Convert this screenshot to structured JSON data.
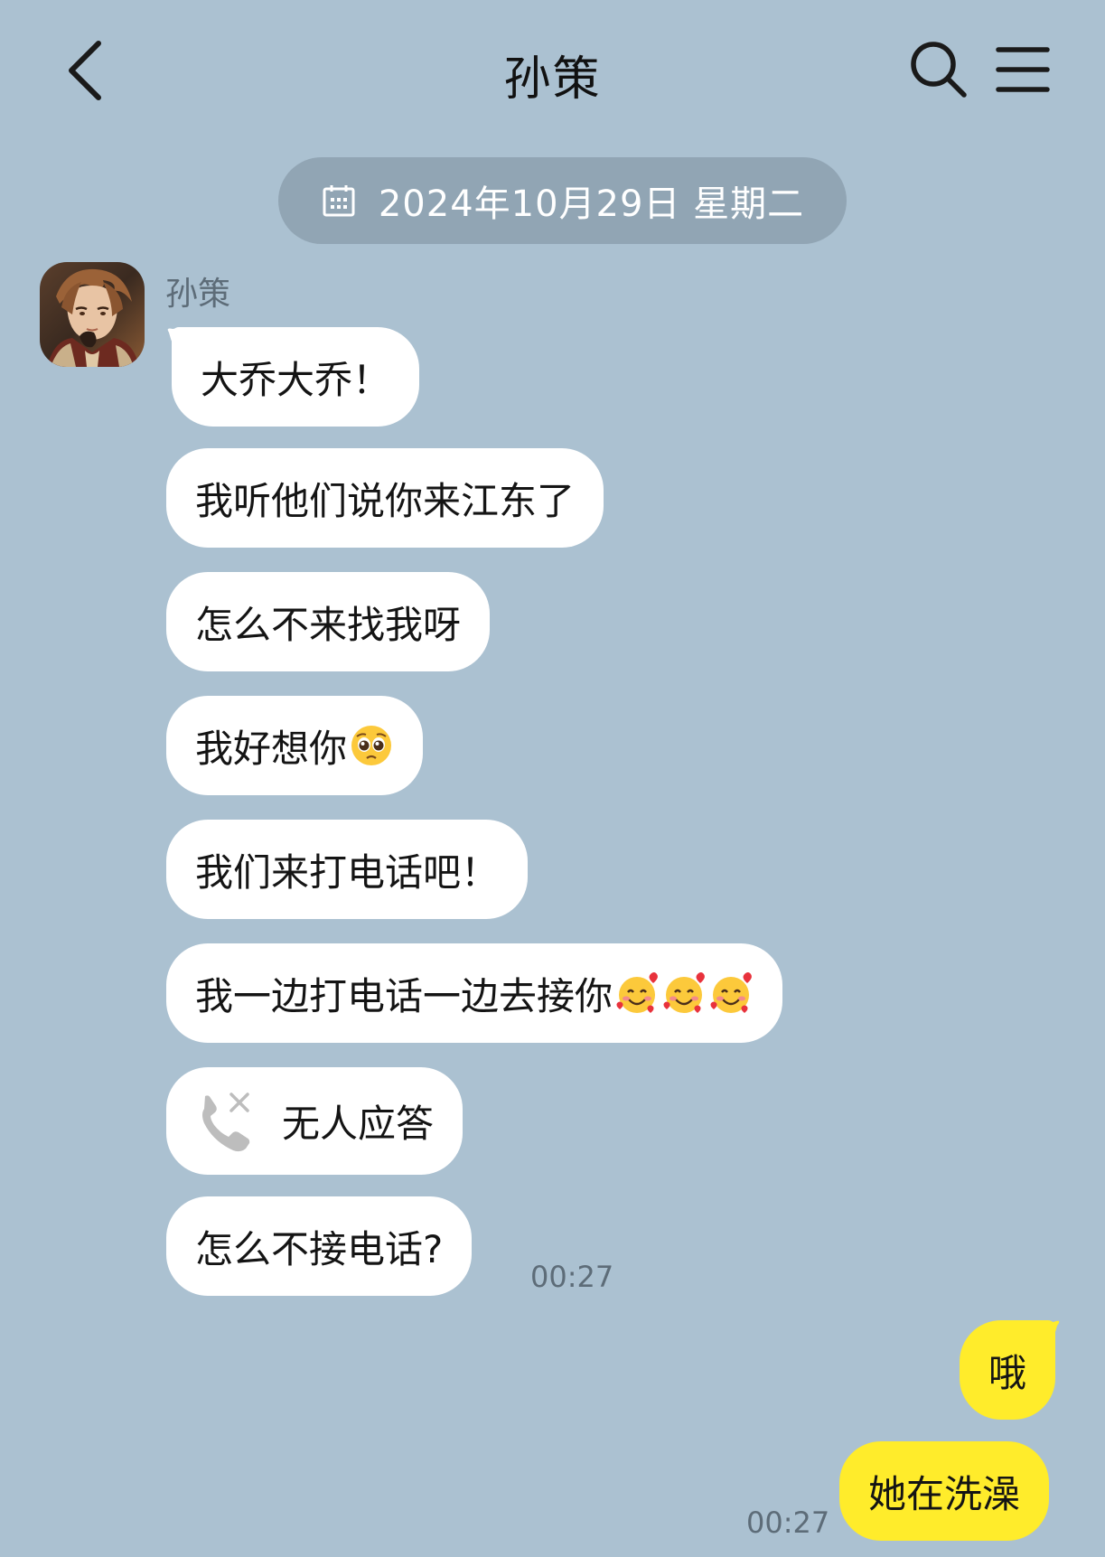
{
  "header": {
    "title": "孙策",
    "icons": {
      "back": "chevron-left-icon",
      "search": "search-icon",
      "menu": "menu-icon"
    }
  },
  "date_divider": {
    "icon": "calendar-icon",
    "text": "2024年10月29日 星期二"
  },
  "contact": {
    "name": "孙策",
    "avatar": "avatar"
  },
  "messages_received": [
    {
      "text": "大乔大乔！"
    },
    {
      "text": "我听他们说你来江东了"
    },
    {
      "text": "怎么不来找我呀"
    },
    {
      "text": "我好想你",
      "emoji": [
        "pleading-face"
      ]
    },
    {
      "text": "我们来打电话吧！"
    },
    {
      "text": "我一边打电话一边去接你",
      "emoji": [
        "smiling-face-with-hearts",
        "smiling-face-with-hearts",
        "smiling-face-with-hearts"
      ]
    },
    {
      "type": "missed-call",
      "icon": "missed-call-icon",
      "text": "无人应答"
    },
    {
      "text": "怎么不接电话?"
    }
  ],
  "received_time": "00:27",
  "messages_sent": [
    {
      "text": "哦"
    },
    {
      "text": "她在洗澡"
    }
  ],
  "sent_time": "00:27",
  "colors": {
    "background": "#abc1d1",
    "received_bubble": "#ffffff",
    "sent_bubble": "#ffec2b",
    "date_pill": "#91a5b4",
    "meta_text": "#5d6c78"
  }
}
